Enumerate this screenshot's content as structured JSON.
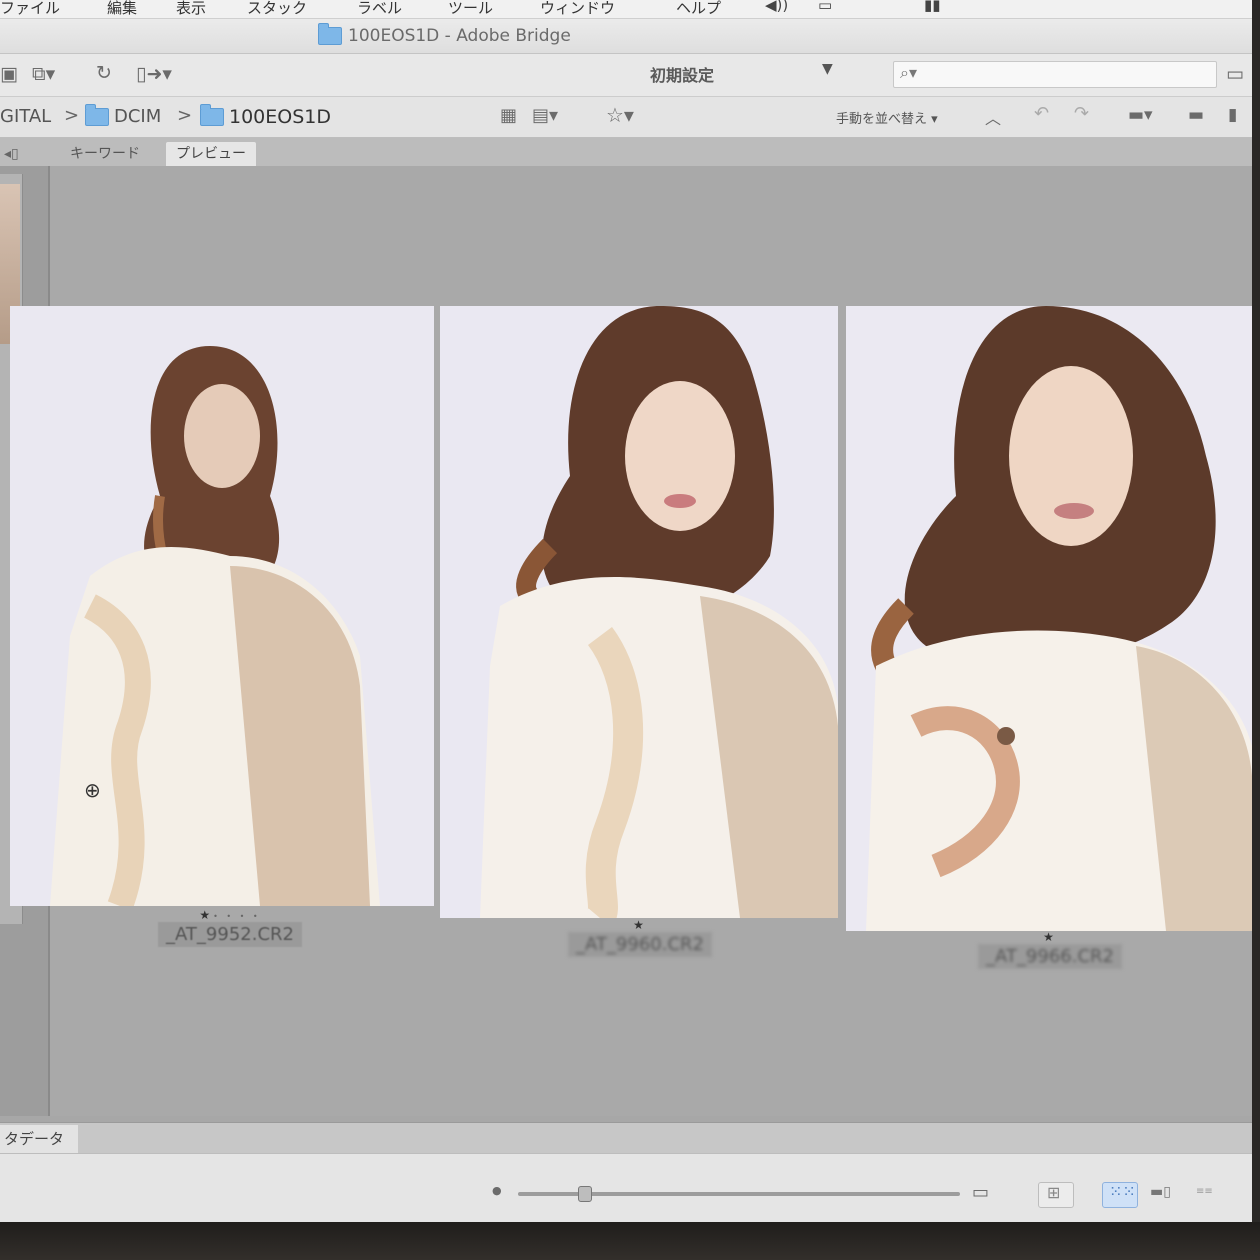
{
  "menu": {
    "items": [
      "ファイル",
      "編集",
      "表示",
      "スタック",
      "ラベル",
      "ツール",
      "ウィンドウ",
      "ヘルプ"
    ]
  },
  "window": {
    "title": "100EOS1D - Adobe Bridge"
  },
  "toolbar": {
    "workspace_label": "初期設定",
    "search_placeholder": "",
    "sort_label": "手動を並べ替え ▾"
  },
  "breadcrumb": [
    "GITAL",
    "DCIM",
    "100EOS1D"
  ],
  "panel_tabs": [
    "キーワード",
    "プレビュー"
  ],
  "preview": {
    "items": [
      {
        "filename": "_AT_9952.CR2",
        "rating": 1
      },
      {
        "filename": "_AT_9960.CR2",
        "rating": 1
      },
      {
        "filename": "_AT_9966.CR2",
        "rating": 1
      }
    ]
  },
  "metadata_tab": "タデータ",
  "status": {
    "thumb_size": 0.15
  },
  "colors": {
    "accent": "#cfe1f7",
    "folder": "#7eb7e8"
  }
}
